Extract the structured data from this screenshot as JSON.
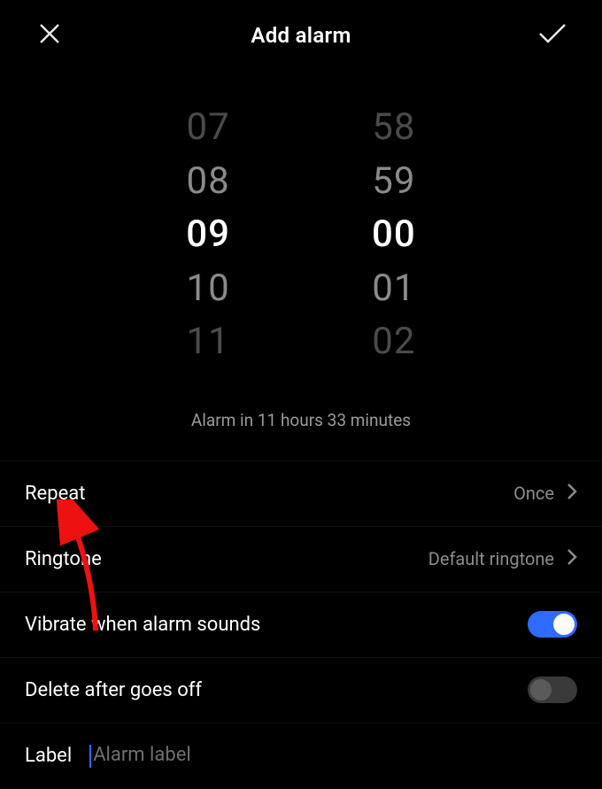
{
  "header": {
    "title": "Add alarm"
  },
  "picker": {
    "hours": [
      "07",
      "08",
      "09",
      "10",
      "11"
    ],
    "minutes": [
      "58",
      "59",
      "00",
      "01",
      "02"
    ]
  },
  "countdown_text": "Alarm in 11 hours 33 minutes",
  "rows": {
    "repeat": {
      "label": "Repeat",
      "value": "Once"
    },
    "ringtone": {
      "label": "Ringtone",
      "value": "Default ringtone"
    },
    "vibrate": {
      "label": "Vibrate when alarm sounds",
      "on": true
    },
    "delete": {
      "label": "Delete after goes off",
      "on": false
    }
  },
  "label_row": {
    "label": "Label",
    "placeholder": "Alarm label"
  },
  "colors": {
    "accent": "#2f6bff",
    "annotation": "#e11"
  }
}
